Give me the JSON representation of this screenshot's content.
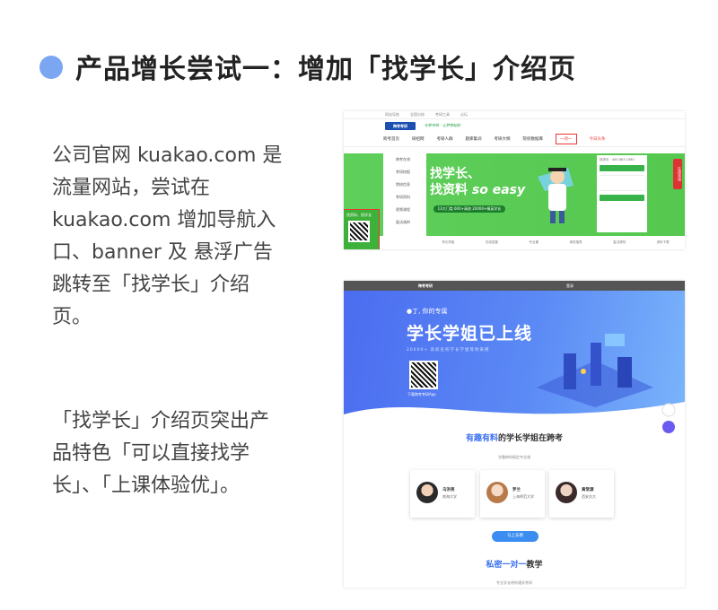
{
  "header": {
    "title": "产品增长尝试一：增加「找学长」介绍页"
  },
  "text": {
    "para1": "公司官网 kuakao.com 是\n流量网站，尝试在\nkuakao.com  增加导航入\n口、banner 及 悬浮广告\n跳转至「找学长」介绍\n页。",
    "para2": "「找学长」介绍页突出产\n品特色「可以直接找学\n长」、「上课体验优」。"
  },
  "shot1": {
    "topbar": [
      "网站导航",
      "全国分校",
      "考研工具",
      "论坛"
    ],
    "logo": "跨考考研",
    "slogan": "在职考研 · 让梦想起航",
    "nav": [
      "跨考首页",
      "研招网",
      "考研人群",
      "题库集训",
      "考研大纲",
      "院校数据库",
      "一对一",
      "今日头条"
    ],
    "menu": [
      "跨考在线",
      "考研快报",
      "院校信息",
      "考研资料",
      "视频课程",
      "复试调剂"
    ],
    "qr_text": "找资料、找学长",
    "banner_line1": "找学长、",
    "banner_line2": "找资料",
    "banner_easy": "so easy",
    "banner_badge": "13大门类 600+高校 20000+精英学长",
    "form_title": "找学长 · 400-883-1080",
    "side_tag": "在线咨询",
    "strip": [
      "学长学姐",
      "在线答疑",
      "专业课",
      "择校指导",
      "复试调剂",
      "资料下载"
    ]
  },
  "shot2": {
    "logo": "跨考考研",
    "top_text": "登录",
    "hero_small": "●丁, 你的专属",
    "hero_big": "学长学姐已上线",
    "hero_sub": "20000+ 高校名校学长学姐等你来撩",
    "qr_label": "下载跨考考研App",
    "section_title_hl": "有趣有料",
    "section_title_rest": "的学长学姐在跨考",
    "section_sub": "学霸带你搞定专业课",
    "cards": [
      {
        "name": "乌洪亮",
        "school": "南海大学"
      },
      {
        "name": "罗兰",
        "school": "上海师范大学"
      },
      {
        "name": "黄常源",
        "school": "西安交大"
      }
    ],
    "button": "马上去撩",
    "section2_title_hl": "私密一对一",
    "section2_title_rest": "教学",
    "section2_sub": "专业学长带你通关考研"
  },
  "colors": {
    "accent_dot": "#7aa6f2",
    "green": "#55c84f",
    "blue": "#4b6cf0",
    "red": "#e33333"
  }
}
